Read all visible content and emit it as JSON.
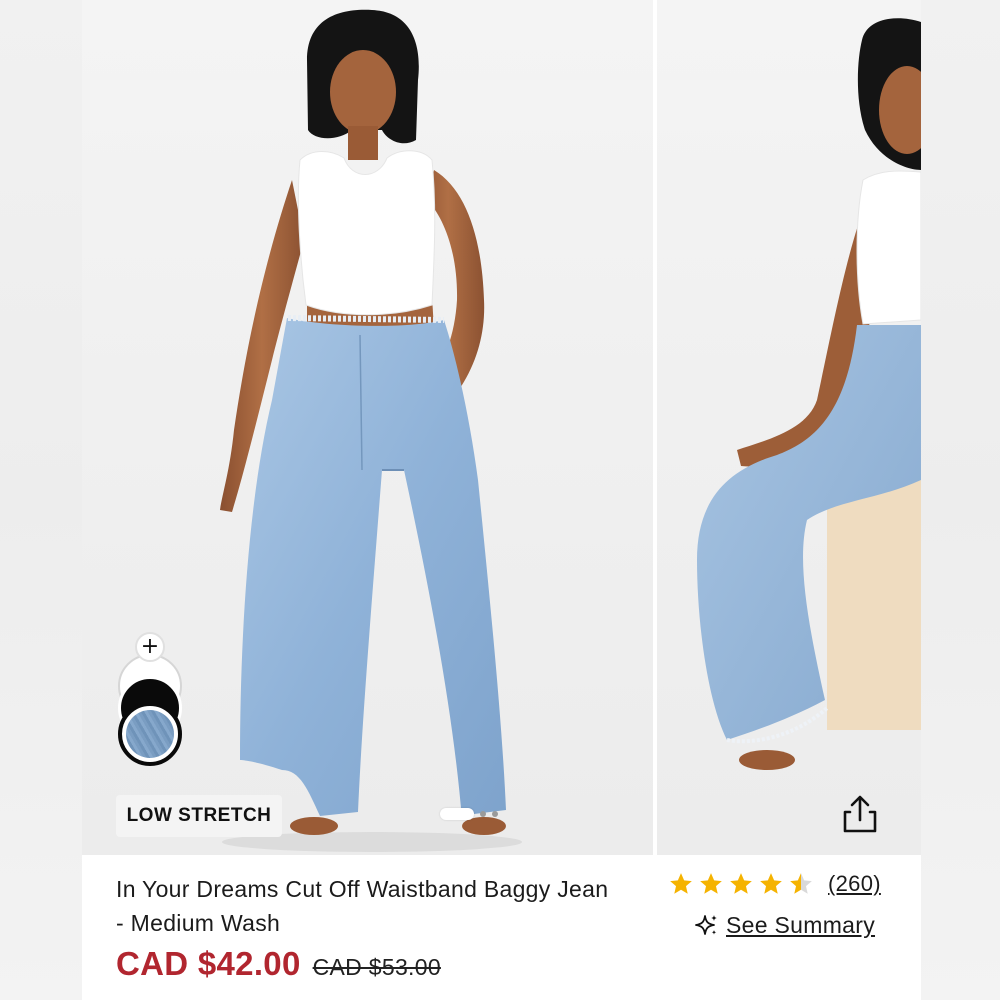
{
  "product": {
    "title": "In Your Dreams Cut Off Waistband Baggy Jean - Medium Wash",
    "price_current": "CAD $42.00",
    "price_original": "CAD $53.00",
    "badge": "LOW STRETCH"
  },
  "rating": {
    "stars": 4.5,
    "review_count": "(260)",
    "summary_label": "See Summary"
  },
  "swatches": {
    "add_label": "+",
    "options": [
      "black",
      "medium-wash"
    ],
    "selected": "medium-wash"
  },
  "carousel": {
    "total_slides": 3,
    "active_index": 0
  },
  "colors": {
    "sale_price": "#b1262f",
    "star_fill": "#f5b301",
    "star_empty": "#d9d9d9",
    "text": "#1b1b1b"
  },
  "icons": {
    "share": "share-icon",
    "summary": "sparkle-icon",
    "star": "star-icon"
  }
}
